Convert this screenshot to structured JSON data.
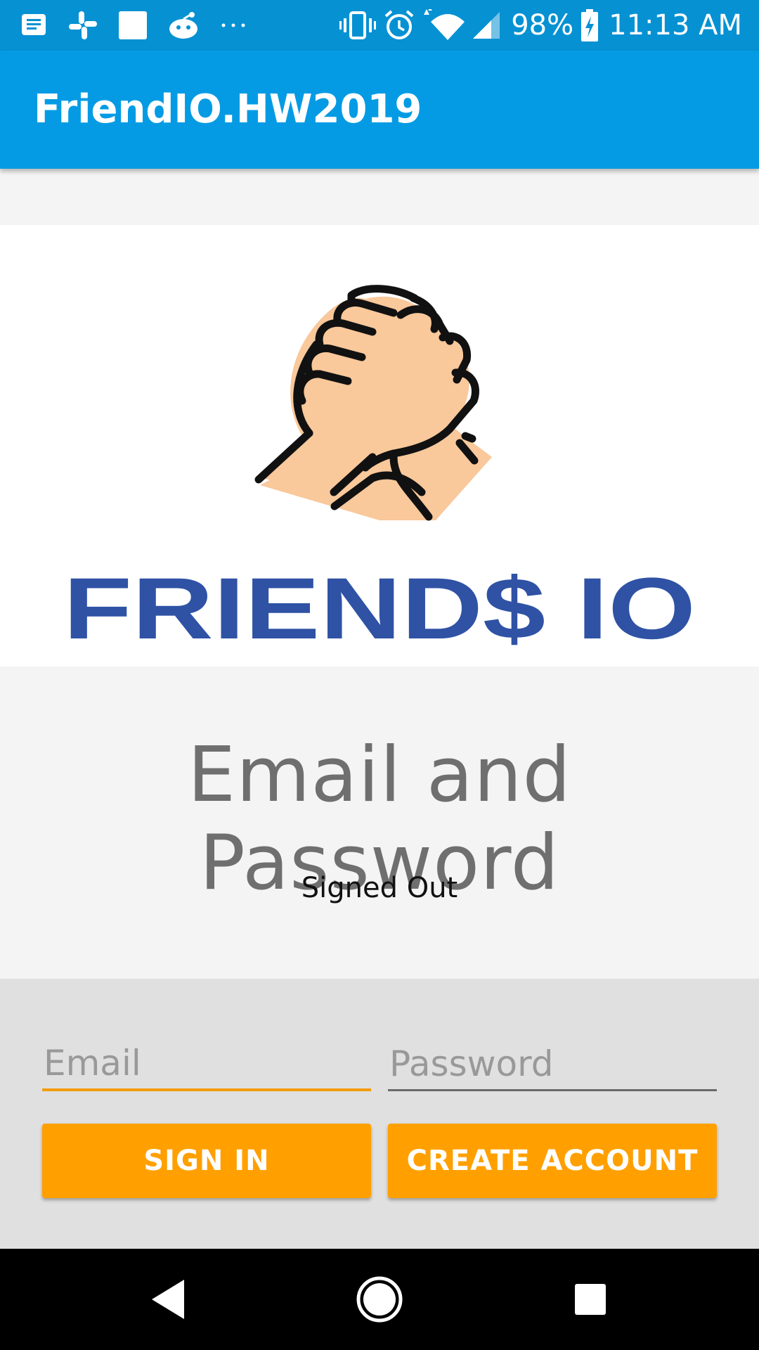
{
  "status_bar": {
    "battery": "98%",
    "time": "11:13 AM",
    "left_icons": [
      "message-icon",
      "slack-icon",
      "square-app-icon",
      "reddit-icon",
      "more-dots-icon"
    ],
    "right_icons": [
      "vibrate-icon",
      "alarm-icon",
      "wifi-icon",
      "signal-icon",
      "battery-charging-icon"
    ]
  },
  "app_bar": {
    "title": "FriendIO.HW2019"
  },
  "logo": {
    "wordmark": "FRIEND$ IO",
    "image": "handshake-illustration"
  },
  "main": {
    "heading": "Email and Password",
    "status": "Signed Out"
  },
  "form": {
    "email_placeholder": "Email",
    "password_placeholder": "Password",
    "signin_label": "SIGN IN",
    "create_label": "CREATE ACCOUNT"
  },
  "colors": {
    "app_bar": "#049be4",
    "status_bar": "#0691d3",
    "accent": "#ffa000",
    "logo_text": "#2f52a5"
  },
  "nav": {
    "icons": [
      "back-icon",
      "home-icon",
      "recents-icon"
    ]
  }
}
